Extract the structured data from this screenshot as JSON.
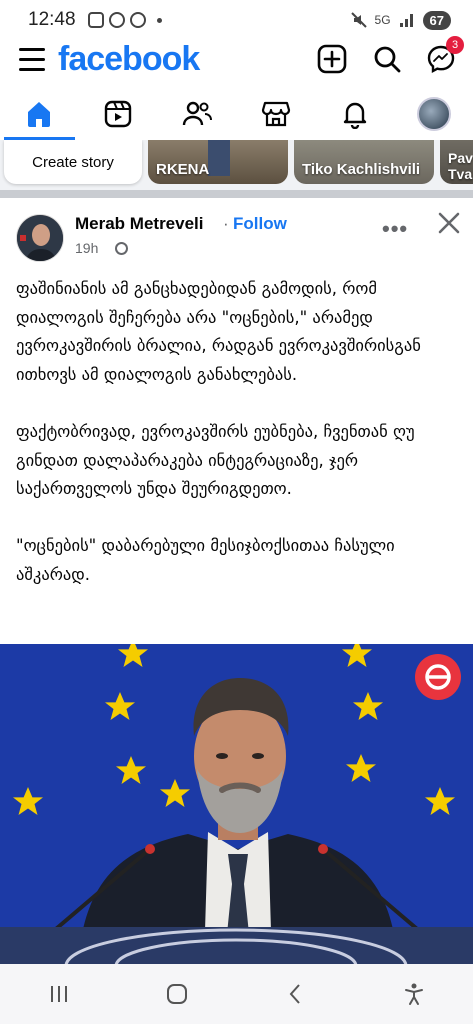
{
  "status_bar": {
    "time": "12:48",
    "battery": "67",
    "network": "5G"
  },
  "header": {
    "logo_text": "facebook",
    "messenger_badge": "3",
    "icons": [
      "menu-icon",
      "add-icon",
      "search-icon",
      "messenger-icon"
    ]
  },
  "nav_tabs": [
    {
      "name": "home-icon",
      "active": true
    },
    {
      "name": "video-icon",
      "active": false
    },
    {
      "name": "friends-icon",
      "active": false
    },
    {
      "name": "marketplace-icon",
      "active": false
    },
    {
      "name": "bell-icon",
      "active": false
    },
    {
      "name": "profile-avatar",
      "active": false
    }
  ],
  "stories": {
    "create_label": "Create story",
    "items": [
      "RKENA",
      "Tiko Kachlishvili",
      "Pav Tva"
    ]
  },
  "post": {
    "author": "Merab Metreveli",
    "separator": "·",
    "follow_label": "Follow",
    "time": "19h",
    "more_label": "•••",
    "paragraphs": [
      "ფაშინიანის ამ განცხადებიდან გამოდის, რომ დიალოგის შეჩერება არა \"ოცნების,\" არამედ ევროკავშირის ბრალია, რადგან ევროკავშირისგან ითხოვს ამ დიალოგის განახლებას.",
      "ფაქტობრივად, ევროკავშირს ეუბნება, ჩვენთან ღუ გინდათ დალაპარაკება ინტეგრაციაზე, ჯერ საქართველოს უნდა შეურიგდეთო.",
      "\"ოცნების\" დაბარებული მესიჯბოქსითაა ჩასული აშკარად."
    ]
  },
  "colors": {
    "brand": "#1877f2",
    "badge": "#e41e3f",
    "eu_blue": "#1c3aa6",
    "eu_star": "#f5cc00"
  }
}
